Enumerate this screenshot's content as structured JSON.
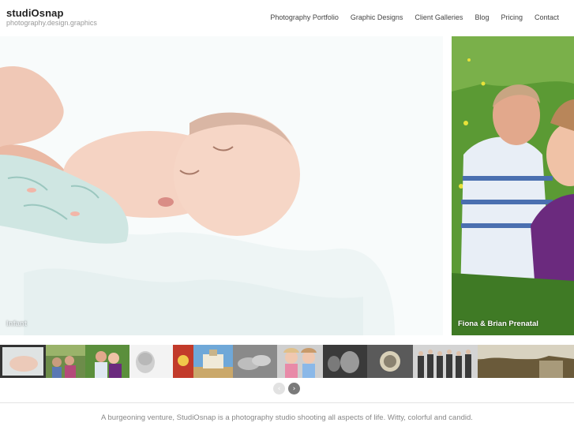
{
  "site": {
    "title": "studiOsnap",
    "tagline": "photography.design.graphics"
  },
  "nav": {
    "items": [
      {
        "label": "Photography Portfolio"
      },
      {
        "label": "Graphic Designs"
      },
      {
        "label": "Client Galleries"
      },
      {
        "label": "Blog"
      },
      {
        "label": "Pricing"
      },
      {
        "label": "Contact"
      }
    ]
  },
  "slider": {
    "main_caption": "Infant",
    "side_caption": "Fiona & Brian Prenatal"
  },
  "thumbnails": {
    "count": 12,
    "active_index": 0
  },
  "controls": {
    "prev_icon": "chevron-left-icon",
    "next_icon": "chevron-right-icon"
  },
  "footer": {
    "text": "A burgeoning venture, StudiOsnap is a photography studio shooting all aspects of life. Witty, colorful and candid."
  },
  "colors": {
    "text_dark": "#222222",
    "text_muted": "#999999",
    "grass_green": "#4d8a2d",
    "active_thumb_border": "#333333"
  }
}
